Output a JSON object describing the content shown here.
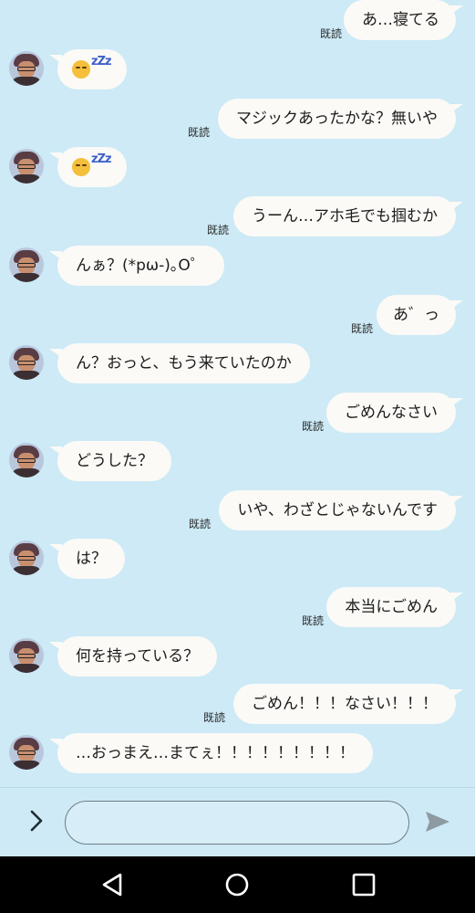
{
  "read_label": "既読",
  "messages": [
    {
      "side": "out",
      "text": "あ…寝てる",
      "read": true
    },
    {
      "side": "in",
      "text": "",
      "sticker": "sleeping-face-zzz"
    },
    {
      "side": "out",
      "text": "マジックあったかな？無いや",
      "read": true
    },
    {
      "side": "in",
      "text": "",
      "sticker": "sleeping-face-zzz"
    },
    {
      "side": "out",
      "text": "うーん…アホ毛でも掴むか",
      "read": true
    },
    {
      "side": "in",
      "text": "んぁ？(*pω-)｡O゜"
    },
    {
      "side": "out",
      "text": "あ゛っ",
      "read": true
    },
    {
      "side": "in",
      "text": "ん？おっと、もう来ていたのか"
    },
    {
      "side": "out",
      "text": "ごめんなさい",
      "read": true
    },
    {
      "side": "in",
      "text": "どうした？"
    },
    {
      "side": "out",
      "text": "いや、わざとじゃないんです",
      "read": true
    },
    {
      "side": "in",
      "text": "は？"
    },
    {
      "side": "out",
      "text": "本当にごめん",
      "read": true
    },
    {
      "side": "in",
      "text": "何を持っている？"
    },
    {
      "side": "out",
      "text": "ごめん！！！なさい！！！",
      "read": true
    },
    {
      "side": "in",
      "text": "…おっまえ…まてぇ！！！！！！！！！"
    }
  ],
  "input": {
    "placeholder": "",
    "value": ""
  },
  "icons": {
    "expand": "chevron-right-icon",
    "send": "send-icon",
    "back": "back-triangle-icon",
    "home": "home-circle-icon",
    "recents": "recents-square-icon"
  },
  "colors": {
    "background": "#cdeaf6",
    "bubble": "#fbfaf6",
    "nav_bar": "#000000"
  }
}
